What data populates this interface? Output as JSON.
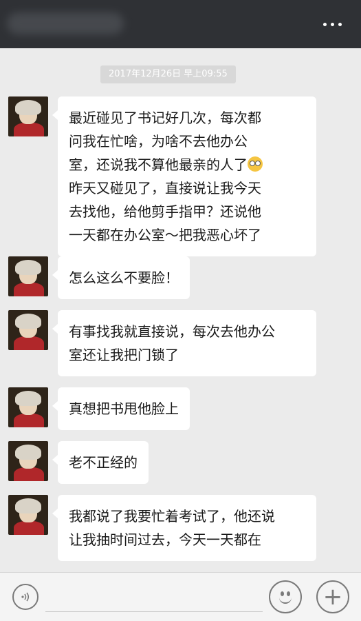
{
  "header": {
    "more_icon": "more-dots-icon"
  },
  "chat": {
    "timestamp": "2017年12月26日 早上09:55",
    "messages": [
      {
        "lines": [
          "最近碰见了书记好几次，每次都",
          "问我在忙啥，为啥不去他办公",
          "室，还说我不算他最亲的人了",
          "昨天又碰见了，直接说让我今天",
          "去找他，给他剪手指甲？还说他",
          "一天都在办公室～把我恶心坏了"
        ]
      },
      {
        "lines": [
          "怎么这么不要脸！"
        ]
      },
      {
        "lines": [
          "有事找我就直接说，每次去他办公",
          "室还让我把门锁了"
        ]
      },
      {
        "lines": [
          "真想把书甩他脸上"
        ]
      },
      {
        "lines": [
          "老不正经的"
        ]
      },
      {
        "lines": [
          "我都说了我要忙着考试了，他还说",
          "让我抽时间过去，今天一天都在"
        ]
      }
    ]
  },
  "input_bar": {
    "voice_icon": "voice-icon",
    "emoji_icon": "emoji-icon",
    "plus_icon": "plus-icon",
    "plus_symbol": "+"
  }
}
